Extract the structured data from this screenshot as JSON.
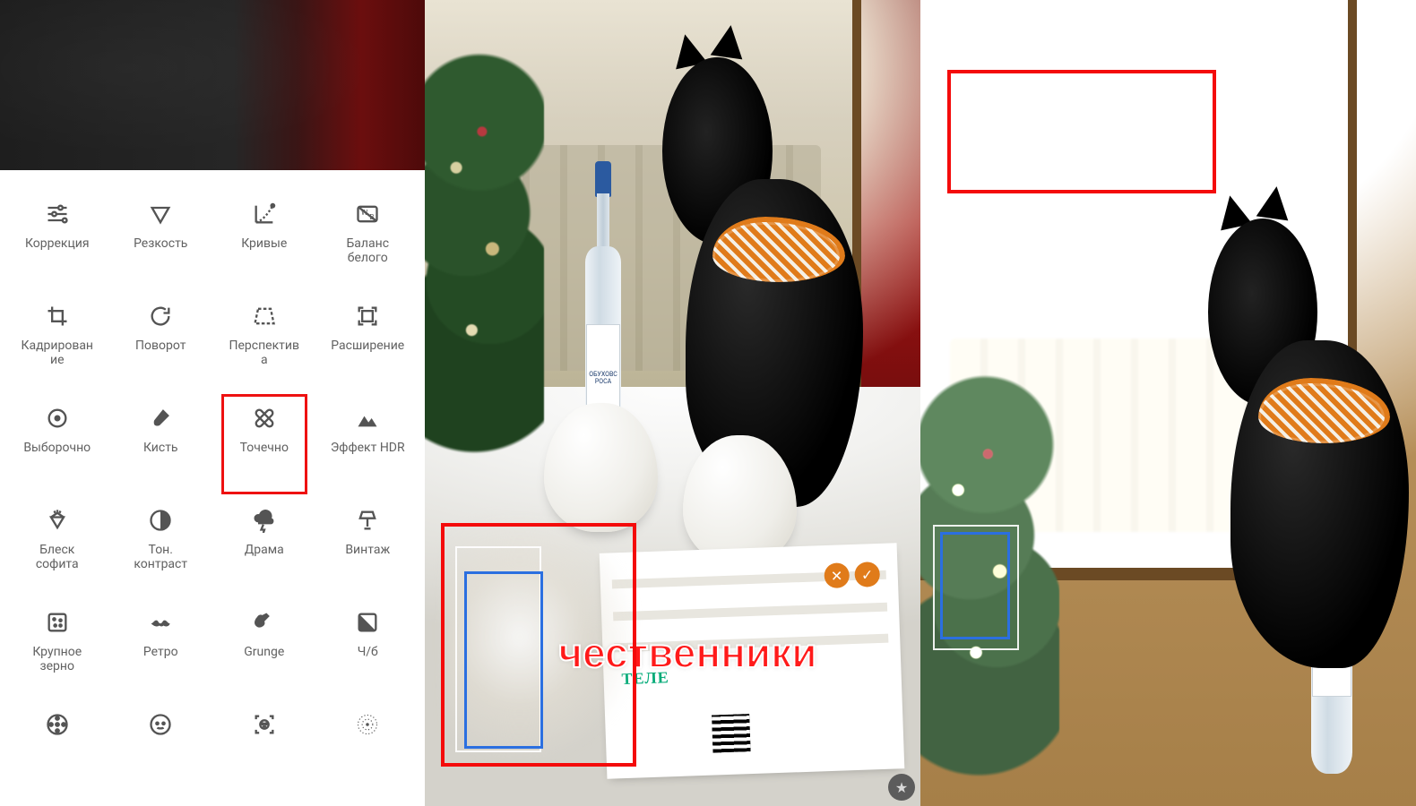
{
  "tools": {
    "row1": [
      {
        "id": "tune",
        "label": "Коррекция"
      },
      {
        "id": "details",
        "label": "Резкость"
      },
      {
        "id": "curves",
        "label": "Кривые"
      },
      {
        "id": "whitebalance",
        "label": "Баланс\nбелого"
      }
    ],
    "row2": [
      {
        "id": "crop",
        "label": "Кадрирован\nие"
      },
      {
        "id": "rotate",
        "label": "Поворот"
      },
      {
        "id": "perspective",
        "label": "Перспектив\nа"
      },
      {
        "id": "expand",
        "label": "Расширение"
      }
    ],
    "row3": [
      {
        "id": "selective",
        "label": "Выборочно"
      },
      {
        "id": "brush",
        "label": "Кисть"
      },
      {
        "id": "healing",
        "label": "Точечно",
        "highlighted": true
      },
      {
        "id": "hdr",
        "label": "Эффект HDR"
      }
    ],
    "row4": [
      {
        "id": "glamour",
        "label": "Блеск\nсофита"
      },
      {
        "id": "tonal",
        "label": "Тон.\nконтраст"
      },
      {
        "id": "drama",
        "label": "Драма"
      },
      {
        "id": "vintage",
        "label": "Винтаж"
      }
    ],
    "row5": [
      {
        "id": "grainy",
        "label": "Крупное\nзерно"
      },
      {
        "id": "retrolux",
        "label": "Ретро"
      },
      {
        "id": "grunge",
        "label": "Grunge"
      },
      {
        "id": "bw",
        "label": "Ч/б"
      }
    ],
    "row6": [
      {
        "id": "noir"
      },
      {
        "id": "portrait"
      },
      {
        "id": "headpose"
      },
      {
        "id": "lensblur"
      }
    ]
  },
  "photo": {
    "bottle_label": "ОБУХОВС\nРОСА",
    "newspaper_header": "ТЕЛЕ",
    "watermark_fragment": "чественники",
    "paper_checks": [
      "✕",
      "✓"
    ]
  }
}
